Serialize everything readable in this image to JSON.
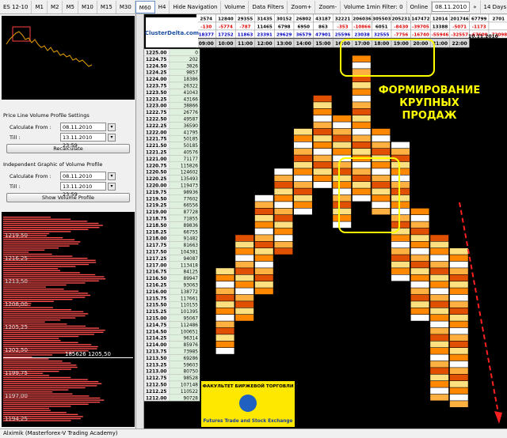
{
  "toolbar": {
    "symbol": "ES 12-10",
    "timeframes": [
      "M1",
      "M2",
      "M5",
      "M10",
      "M15",
      "M30",
      "M60",
      "H4"
    ],
    "active_timeframe": "M60",
    "menus": [
      "Hide Navigation",
      "Volume",
      "Data Filters",
      "Zoom+",
      "Zoom-",
      "Volume 1min Filter: 0",
      "Online"
    ],
    "datetime": "08.11.2010 16:00",
    "days": "14 Days"
  },
  "settings": {
    "price_line_title": "Price Line Volume Profile Settings",
    "calc_from_label": "Calculate From :",
    "calc_from_value": "08.11.2010 00:00",
    "till_label": "Till :",
    "till_value": "13.11.2010 23:59",
    "recalc_button": "Recalculate",
    "independent_title": "Independent Graphic of Volume Profile",
    "calc_from_value2": "08.11.2010 00:00",
    "till_value2": "13.11.2010 23:59",
    "show_button": "Show Volume Profile"
  },
  "histogram": {
    "price_labels": [
      "1219,50",
      "1216,25",
      "1213,50",
      "1208,00",
      "1205,25",
      "1202,50",
      "1199,75",
      "1197,00",
      "1194,25"
    ],
    "marker": "185626  1205,50",
    "color": "#ff4c4c"
  },
  "status_bar": "Alximik (Masterforex-V Trading Academy)",
  "chart": {
    "logo": "ClusterDelta.com",
    "hours": [
      "09:00",
      "10:00",
      "11:00",
      "12:00",
      "13:00",
      "14:00",
      "15:00",
      "16:00",
      "17:00",
      "18:00",
      "19:00",
      "20:00",
      "21:00",
      "22:00"
    ],
    "date_label": "10.11.2010",
    "header_rows": [
      [
        "2574",
        "12840",
        "29355",
        "31435",
        "30152",
        "26802",
        "43187",
        "32221",
        "206036",
        "305503",
        "205231",
        "147472",
        "12014",
        "201746",
        "67799",
        "2701"
      ],
      [
        "-130",
        "-5774",
        "-787",
        "11465",
        "6798",
        "6950",
        "863",
        "-353",
        "-10866",
        "6051",
        "-8430",
        "-39705",
        "13388",
        "-5071",
        "-1173",
        ""
      ],
      [
        "18377",
        "17252",
        "11863",
        "23391",
        "29629",
        "36579",
        "47901",
        "25596",
        "23038",
        "32555",
        "-7756",
        "-16740",
        "-55946",
        "-32557",
        "-67600",
        "-72098"
      ]
    ],
    "annotation_line1": "ФОРМИРОВАНИЕ",
    "annotation_line2": "КРУПНЫХ",
    "annotation_line3": "ПРОДАЖ",
    "banner_title": "ФАКУЛЬТЕТ БИРЖЕВОЙ ТОРГОВЛИ",
    "banner_sub": "Futures Trade and Stock Exchange",
    "prices": [
      {
        "p": "1225.00",
        "v": "0"
      },
      {
        "p": "1224.75",
        "v": "202"
      },
      {
        "p": "1224.50",
        "v": "3826"
      },
      {
        "p": "1224.25",
        "v": "9857"
      },
      {
        "p": "1224.00",
        "v": "18386"
      },
      {
        "p": "1223.75",
        "v": "26322"
      },
      {
        "p": "1223.50",
        "v": "41043"
      },
      {
        "p": "1223.25",
        "v": "43166"
      },
      {
        "p": "1223.00",
        "v": "38866"
      },
      {
        "p": "1222.75",
        "v": "26776"
      },
      {
        "p": "1222.50",
        "v": "49587"
      },
      {
        "p": "1222.25",
        "v": "36590"
      },
      {
        "p": "1222.00",
        "v": "41795"
      },
      {
        "p": "1221.75",
        "v": "50185"
      },
      {
        "p": "1221.50",
        "v": "50185"
      },
      {
        "p": "1221.25",
        "v": "40576"
      },
      {
        "p": "1221.00",
        "v": "71177"
      },
      {
        "p": "1220.75",
        "v": "115826"
      },
      {
        "p": "1220.50",
        "v": "124602"
      },
      {
        "p": "1220.25",
        "v": "135493"
      },
      {
        "p": "1220.00",
        "v": "119473"
      },
      {
        "p": "1219.75",
        "v": "98936"
      },
      {
        "p": "1219.50",
        "v": "77602"
      },
      {
        "p": "1219.25",
        "v": "66556"
      },
      {
        "p": "1219.00",
        "v": "87728"
      },
      {
        "p": "1218.75",
        "v": "71855"
      },
      {
        "p": "1218.50",
        "v": "89836"
      },
      {
        "p": "1218.25",
        "v": "66755"
      },
      {
        "p": "1218.00",
        "v": "91482"
      },
      {
        "p": "1217.75",
        "v": "81663"
      },
      {
        "p": "1217.50",
        "v": "104381"
      },
      {
        "p": "1217.25",
        "v": "94087"
      },
      {
        "p": "1217.00",
        "v": "113418"
      },
      {
        "p": "1216.75",
        "v": "84125"
      },
      {
        "p": "1216.50",
        "v": "89947"
      },
      {
        "p": "1216.25",
        "v": "93063"
      },
      {
        "p": "1216.00",
        "v": "138772"
      },
      {
        "p": "1215.75",
        "v": "117661"
      },
      {
        "p": "1215.50",
        "v": "110155"
      },
      {
        "p": "1215.25",
        "v": "101395"
      },
      {
        "p": "1215.00",
        "v": "95067"
      },
      {
        "p": "1214.75",
        "v": "112486"
      },
      {
        "p": "1214.50",
        "v": "100651"
      },
      {
        "p": "1214.25",
        "v": "96314"
      },
      {
        "p": "1214.00",
        "v": "85976"
      },
      {
        "p": "1213.75",
        "v": "73985"
      },
      {
        "p": "1213.50",
        "v": "69286"
      },
      {
        "p": "1213.25",
        "v": "59603"
      },
      {
        "p": "1213.00",
        "v": "80750"
      },
      {
        "p": "1212.75",
        "v": "98528"
      },
      {
        "p": "1212.50",
        "v": "107148"
      },
      {
        "p": "1212.25",
        "v": "110522"
      },
      {
        "p": "1212.00",
        "v": "90728"
      }
    ]
  }
}
